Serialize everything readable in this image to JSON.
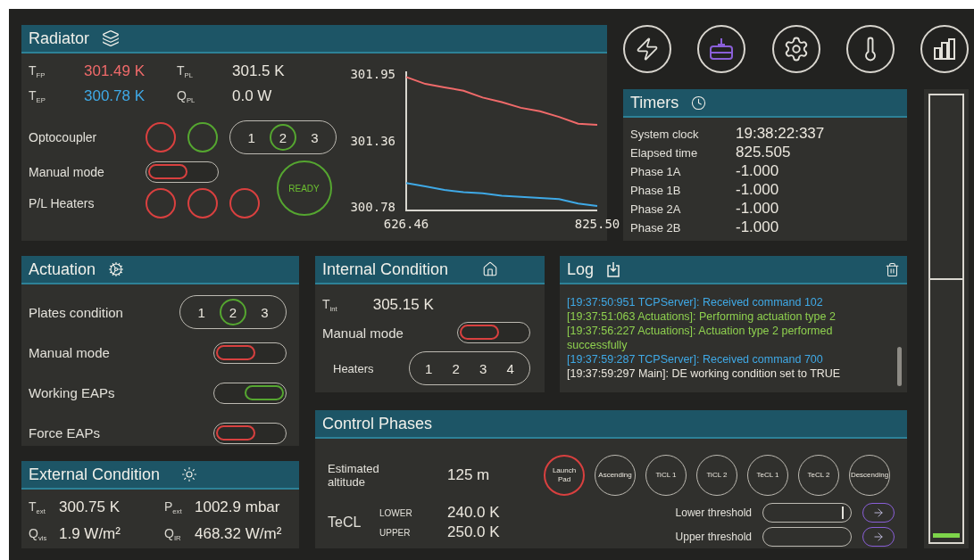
{
  "nav_buttons": [
    {
      "kind": "power",
      "selected": false
    },
    {
      "kind": "machine",
      "selected": true
    },
    {
      "kind": "settings",
      "selected": false
    },
    {
      "kind": "thermometer",
      "selected": false
    },
    {
      "kind": "chart",
      "selected": false
    }
  ],
  "radiator": {
    "title": "Radiator",
    "readings": [
      {
        "symbol": "T$_{FP}$",
        "value": "301.49 K",
        "color": "#f06a6a"
      },
      {
        "symbol": "T$_{PL}$",
        "value": "301.5 K",
        "color": "#ece8df"
      },
      {
        "symbol": "T$_{EP}$",
        "value": "300.78 K",
        "color": "#3fa9e6"
      },
      {
        "symbol": "Q$_{PL}$",
        "value": "0.0 W",
        "color": "#ece8df"
      }
    ],
    "optocoupler": {
      "label": "Optocoupler",
      "indicators": [
        {
          "on": false
        },
        {
          "on": true
        }
      ],
      "options": [
        {
          "label": "1",
          "selected": false
        },
        {
          "label": "2",
          "selected": true
        },
        {
          "label": "3",
          "selected": false
        }
      ]
    },
    "manual_mode": {
      "label": "Manual mode",
      "on": false
    },
    "heaters": {
      "label": "P/L Heaters",
      "indicators": [
        {
          "on": false
        },
        {
          "on": false
        },
        {
          "on": false
        }
      ]
    },
    "ready": {
      "label": "READY",
      "on": true
    },
    "chart_data": {
      "type": "line",
      "x": [
        626.46,
        646.4,
        666.3,
        686.2,
        706.1,
        726.0,
        745.9,
        765.8,
        785.7,
        805.6,
        825.5
      ],
      "series": [
        {
          "color": "#f06a6a",
          "values": [
            301.92,
            301.86,
            301.83,
            301.8,
            301.74,
            301.7,
            301.65,
            301.62,
            301.57,
            301.51,
            301.5
          ]
        },
        {
          "color": "#3fa9e6",
          "values": [
            300.99,
            300.96,
            300.93,
            300.91,
            300.9,
            300.88,
            300.87,
            300.86,
            300.85,
            300.81,
            300.79
          ]
        }
      ],
      "xlim": [
        626.46,
        825.5
      ],
      "ylim": [
        300.75,
        301.97
      ],
      "xticks": [
        626.46,
        {
          "value": 825.5,
          "label": "825.50"
        }
      ],
      "yticks": [
        300.78,
        301.36,
        301.95
      ]
    }
  },
  "timers": {
    "title": "Timers",
    "rows": [
      {
        "label": "System clock",
        "value": "19:38:22:337"
      },
      {
        "label": "Elapsed time",
        "value": "825.505"
      },
      {
        "label": "Phase 1A",
        "value": "-1.000"
      },
      {
        "label": "Phase 1B",
        "value": "-1.000"
      },
      {
        "label": "Phase 2A",
        "value": "-1.000"
      },
      {
        "label": "Phase 2B",
        "value": "-1.000"
      }
    ]
  },
  "meter": {
    "level": 0.01
  },
  "actuation": {
    "title": "Actuation",
    "rows": [
      {
        "kind": "selector",
        "label": "Plates condition",
        "options": [
          {
            "label": "1",
            "selected": false
          },
          {
            "label": "2",
            "selected": true
          },
          {
            "label": "3",
            "selected": false
          }
        ]
      },
      {
        "kind": "toggle",
        "label": "Manual mode",
        "on": false
      },
      {
        "kind": "toggle",
        "label": "Working EAPs",
        "on": true
      },
      {
        "kind": "toggle",
        "label": "Force EAPs",
        "on": false
      }
    ]
  },
  "internal": {
    "title": "Internal Condition",
    "reading": {
      "symbol": "T$_{int}$",
      "value": "305.15 K"
    },
    "manual_mode": {
      "label": "Manual mode",
      "on": false
    },
    "heaters": {
      "label": "Heaters",
      "options": [
        {
          "label": "1",
          "selected": false
        },
        {
          "label": "2",
          "selected": false
        },
        {
          "label": "3",
          "selected": false
        },
        {
          "label": "4",
          "selected": false
        }
      ]
    }
  },
  "log": {
    "title": "Log",
    "lines": [
      {
        "text": "[19:37:50:951 TCPServer]: Received command 102",
        "color": "#3fa9e6"
      },
      {
        "text": "[19:37:51:063 Actuations]: Performing actuation type 2",
        "color": "#8fd14f"
      },
      {
        "text": "[19:37:56:227 Actuations]: Actuation type 2 performed successfully",
        "color": "#8fd14f"
      },
      {
        "text": "[19:37:59:287 TCPServer]: Received command 700",
        "color": "#3fa9e6"
      },
      {
        "text": "[19:37:59:297 Main]: DE working condition set to TRUE",
        "color": "#ece8df"
      }
    ]
  },
  "external": {
    "title": "External Condition",
    "readings": [
      {
        "symbol": "T$_{ext}$",
        "value": "300.75 K"
      },
      {
        "symbol": "P$_{ext}$",
        "value": "1002.9 mbar"
      },
      {
        "symbol": "Q$_{vis}$",
        "value": "1.9 W/m²"
      },
      {
        "symbol": "Q$_{IR}$",
        "value": "468.32 W/m²"
      }
    ]
  },
  "control_phases": {
    "title": "Control Phases",
    "altitude": {
      "label": "Estimated altitude",
      "value": "125 m"
    },
    "phases": [
      {
        "label": "Launch Pad",
        "selected": true
      },
      {
        "label": "Ascending",
        "selected": false
      },
      {
        "label": "TiCL 1",
        "selected": false
      },
      {
        "label": "TiCL 2",
        "selected": false
      },
      {
        "label": "TeCL 1",
        "selected": false
      },
      {
        "label": "TeCL 2",
        "selected": false
      },
      {
        "label": "Descending",
        "selected": false
      }
    ],
    "tecl": {
      "label": "TeCL",
      "bounds": [
        {
          "label": "LOWER",
          "value": "240.0 K"
        },
        {
          "label": "UPPER",
          "value": "250.0 K"
        }
      ]
    },
    "thresholds": [
      {
        "label": "Lower threshold",
        "focused": true
      },
      {
        "label": "Upper threshold",
        "focused": false
      }
    ]
  }
}
